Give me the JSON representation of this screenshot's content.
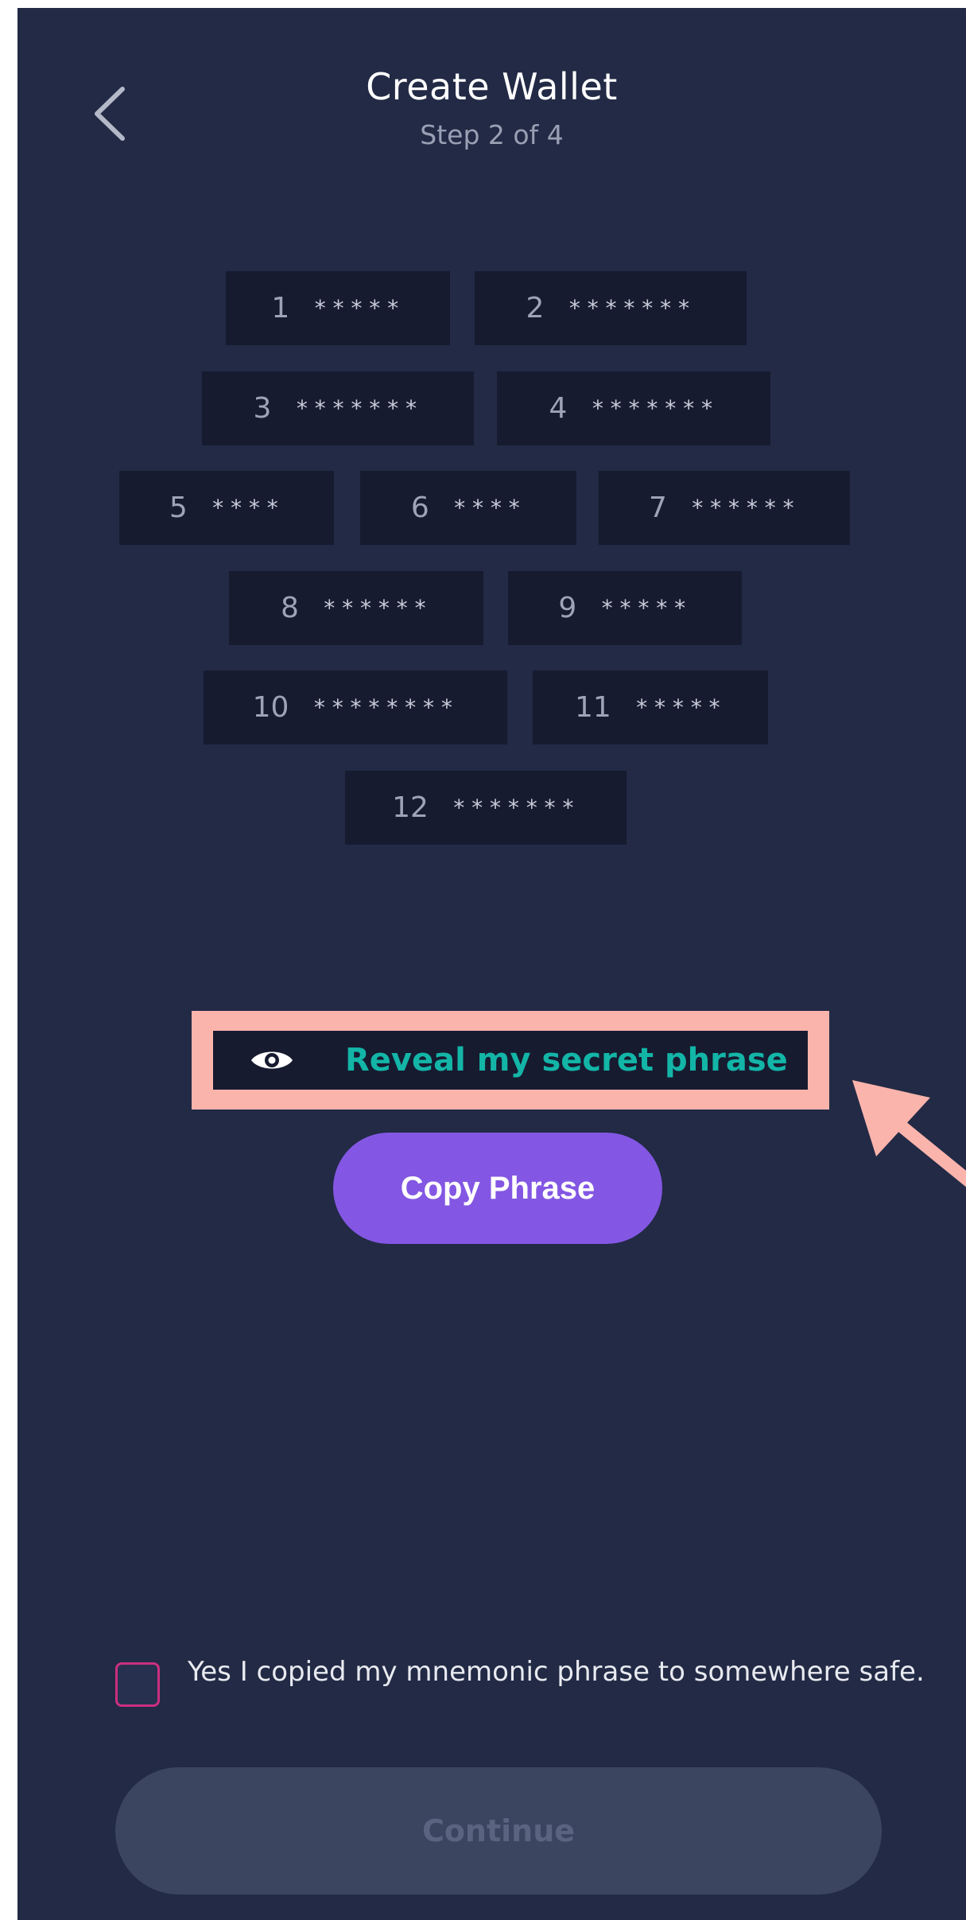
{
  "header": {
    "title": "Create Wallet",
    "step": "Step 2 of 4"
  },
  "phrase_words": [
    {
      "index": "1",
      "mask": "*****"
    },
    {
      "index": "2",
      "mask": "*******"
    },
    {
      "index": "3",
      "mask": "*******"
    },
    {
      "index": "4",
      "mask": "*******"
    },
    {
      "index": "5",
      "mask": "****"
    },
    {
      "index": "6",
      "mask": "****"
    },
    {
      "index": "7",
      "mask": "******"
    },
    {
      "index": "8",
      "mask": "******"
    },
    {
      "index": "9",
      "mask": "*****"
    },
    {
      "index": "10",
      "mask": "********"
    },
    {
      "index": "11",
      "mask": "*****"
    },
    {
      "index": "12",
      "mask": "*******"
    }
  ],
  "reveal": {
    "label": "Reveal my secret phrase",
    "icon": "eye-icon"
  },
  "copy_button": {
    "label": "Copy Phrase"
  },
  "consent": {
    "label": "Yes I copied my mnemonic phrase to somewhere safe.",
    "checked": false
  },
  "continue_button": {
    "label": "Continue",
    "enabled": false
  },
  "colors": {
    "background": "#222a45",
    "chip": "#161b30",
    "accent_teal": "#13b5a7",
    "accent_purple": "#8357e3",
    "checkbox_border": "#cc2f7e",
    "highlight": "#fbb4ac"
  }
}
